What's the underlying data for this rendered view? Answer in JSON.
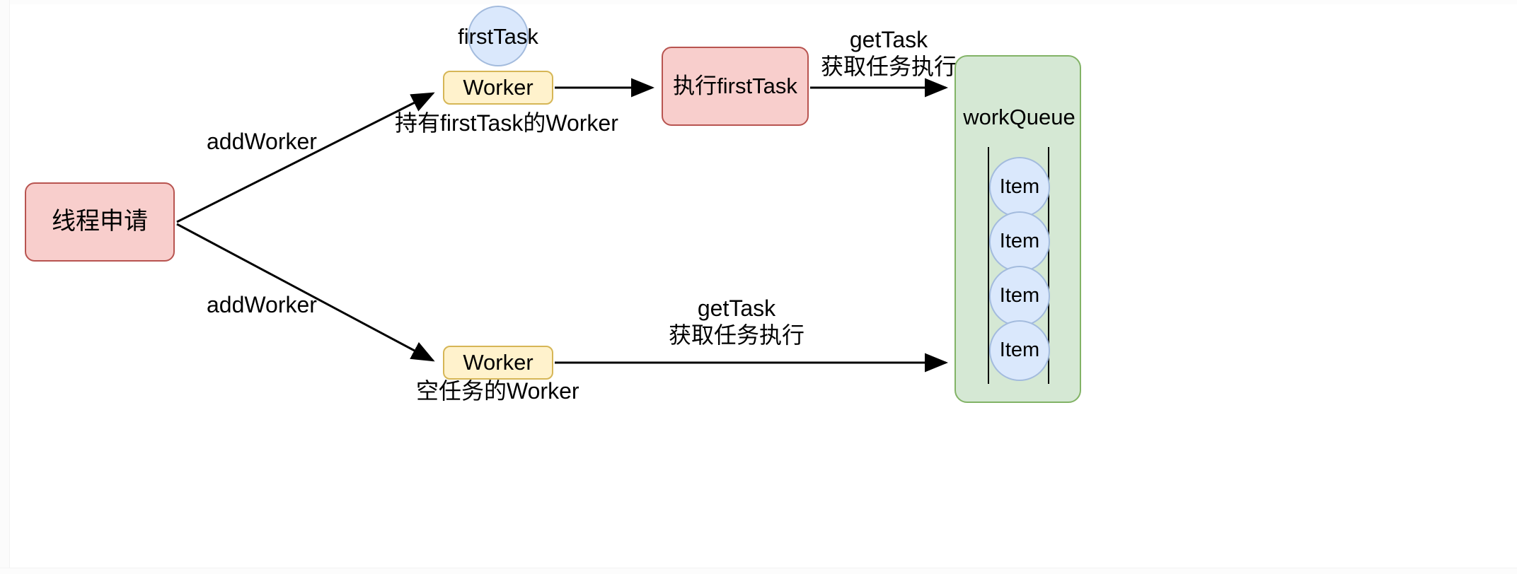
{
  "diagram": {
    "title": "Thread pool worker dispatch diagram",
    "colors": {
      "pink_fill": "#f8cecc",
      "pink_stroke": "#b85450",
      "yellow_fill": "#fff2cc",
      "yellow_stroke": "#d6b656",
      "green_fill": "#d5e8d4",
      "green_stroke": "#82b366",
      "blue_fill": "#dae8fc",
      "blue_stroke": "#a3bbdd",
      "edge_stroke": "#000000",
      "background": "#ffffff"
    },
    "nodes": {
      "thread_apply": "线程申请",
      "first_task": "firstTask",
      "worker_top": "Worker",
      "worker_bottom": "Worker",
      "exec_first_task": "执行firstTask",
      "work_queue": "workQueue",
      "queue_items": [
        "Item",
        "Item",
        "Item",
        "Item"
      ]
    },
    "edge_labels": {
      "add_worker_top": "addWorker",
      "add_worker_bottom": "addWorker",
      "hold_first_task_worker": "持有firstTask的Worker",
      "empty_task_worker": "空任务的Worker",
      "get_task_top": "getTask\n获取任务执行",
      "get_task_bottom": "getTask\n获取任务执行"
    }
  }
}
